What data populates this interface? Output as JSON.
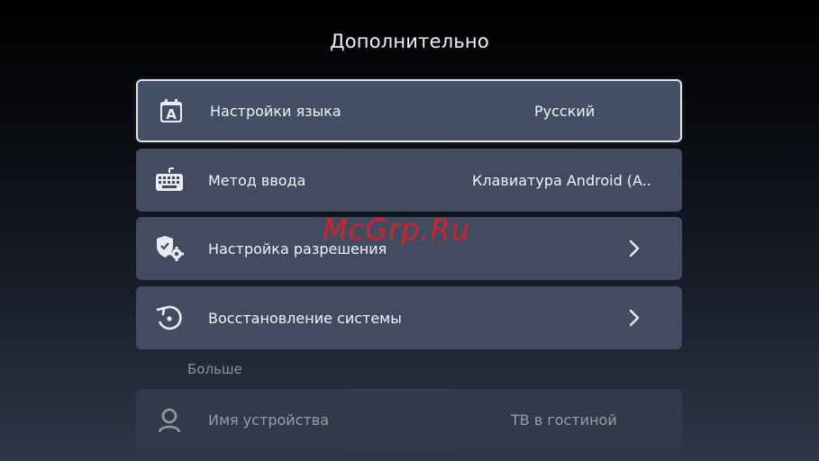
{
  "page": {
    "title": "Дополнительно"
  },
  "menu": {
    "items": [
      {
        "label": "Настройки языка",
        "value": "Русский",
        "icon": "language-icon"
      },
      {
        "label": "Метод ввода",
        "value": "Клавиатура Android (A..",
        "icon": "keyboard-icon"
      },
      {
        "label": "Настройка разрешения",
        "icon": "permissions-icon",
        "chevron": "›"
      },
      {
        "label": "Восстановление системы",
        "icon": "restore-icon",
        "chevron": "›"
      }
    ]
  },
  "more": {
    "header": "Больше",
    "items": [
      {
        "label": "Имя устройства",
        "value": "ТВ в гостиной",
        "icon": "device-icon"
      }
    ]
  },
  "watermark": "McGrp.Ru",
  "colors": {
    "item_bg": "#424b60",
    "focus_border": "#dfe3ec",
    "watermark": "#dc1e28"
  }
}
